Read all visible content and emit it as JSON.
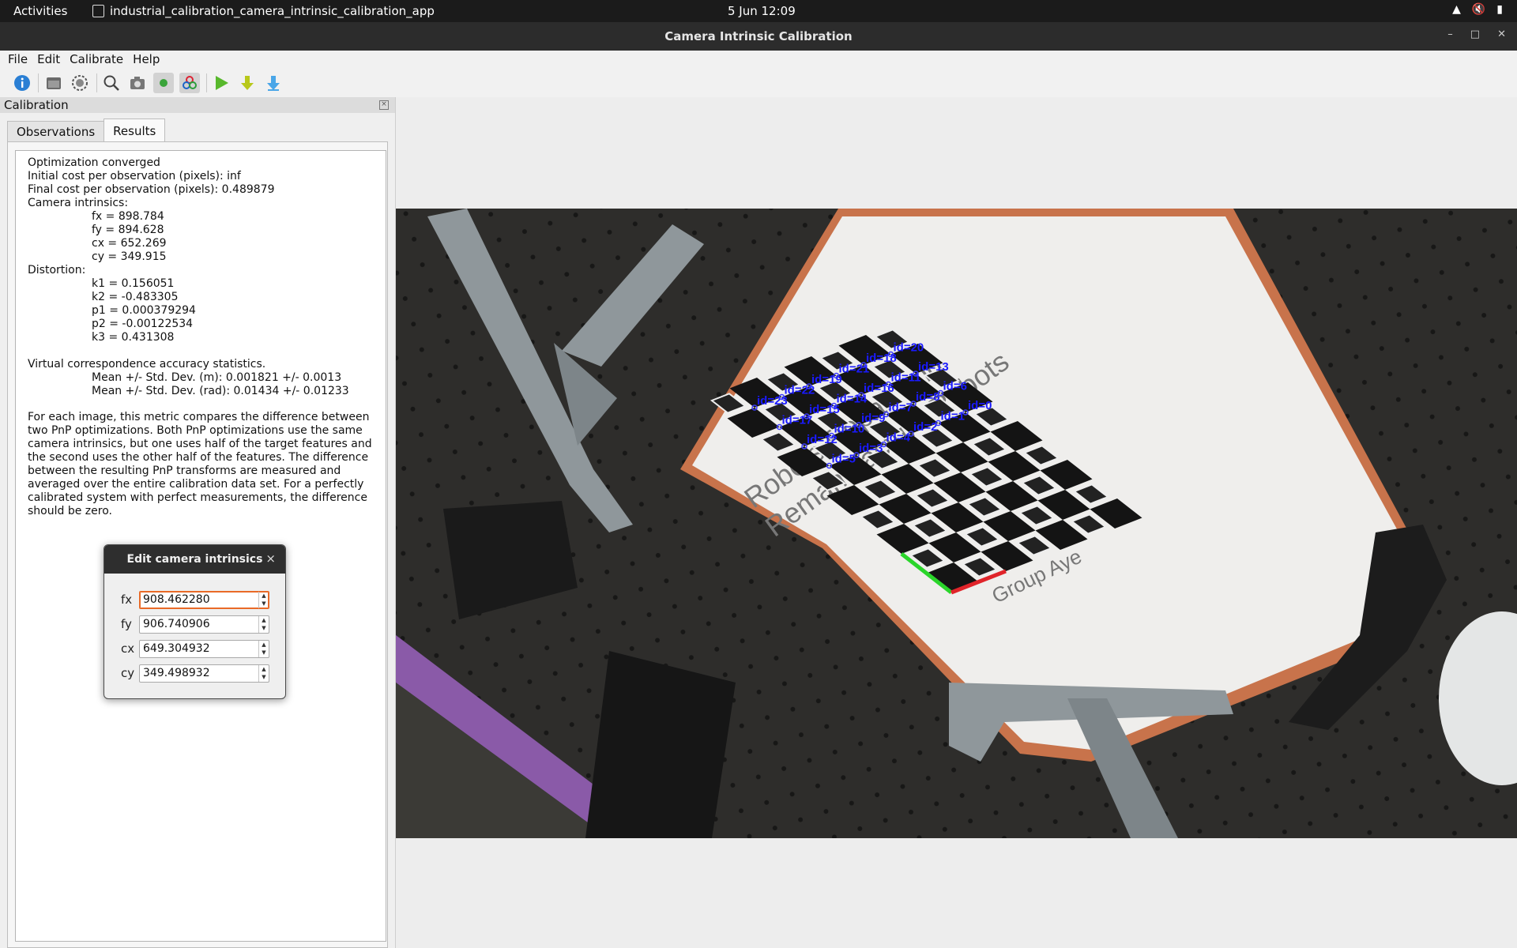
{
  "topbar": {
    "activities": "Activities",
    "app_title": "industrial_calibration_camera_intrinsic_calibration_app",
    "clock": "5 Jun  12:09"
  },
  "window": {
    "title": "Camera Intrinsic Calibration"
  },
  "menu": {
    "file": "File",
    "edit": "Edit",
    "calibrate": "Calibrate",
    "help": "Help"
  },
  "toolbar": {
    "icons": [
      "info-icon",
      "open-folder-icon",
      "settings-gear-icon",
      "zoom-inspect-icon",
      "camera-icon",
      "record-dot-icon",
      "robot-target-icon",
      "play-icon",
      "download-icon",
      "save-icon"
    ]
  },
  "dock": {
    "title": "Calibration",
    "tabs": {
      "observations": "Observations",
      "results": "Results"
    }
  },
  "results": {
    "l1": "Optimization converged",
    "l2": "Initial cost per observation (pixels): inf",
    "l3": "Final cost per observation (pixels): 0.489879",
    "l4": "Camera intrinsics:",
    "fx": "fx = 898.784",
    "fy": "fy = 894.628",
    "cx": "cx = 652.269",
    "cy": "cy = 349.915",
    "distortion": "Distortion:",
    "k1": "k1 = 0.156051",
    "k2": "k2 = -0.483305",
    "p1": "p1 = 0.000379294",
    "p2": "p2 = -0.00122534",
    "k3": "k3 = 0.431308",
    "vc": "Virtual correspondence accuracy statistics.",
    "mean_m": "Mean +/- Std. Dev. (m): 0.001821 +/- 0.0013",
    "mean_rad": "Mean +/- Std. Dev. (rad): 0.01434 +/- 0.01233",
    "paragraph": "For each image, this metric compares the difference between two PnP optimizations. Both PnP optimizations use the same camera intrinsics, but one uses half of the target features and the second uses the other half of the features. The difference between the resulting PnP transforms are measured and averaged over the entire calibration data set. For a perfectly calibrated system with perfect measurements, the difference should be zero."
  },
  "dialog": {
    "title": "Edit camera intrinsics",
    "fields": [
      {
        "label": "fx",
        "value": "908.462280"
      },
      {
        "label": "fy",
        "value": "906.740906"
      },
      {
        "label": "cx",
        "value": "649.304932"
      },
      {
        "label": "cy",
        "value": "349.498932"
      }
    ]
  },
  "camera_image": {
    "board_text_line1": "Robots Repair and",
    "board_text_line2": "Remanufacture Robots",
    "board_text_bottom": "Group Aye",
    "marker_labels": [
      "id=23",
      "id=22",
      "id=19",
      "id=21",
      "id=18",
      "id=20",
      "id=17",
      "id=15",
      "id=14",
      "id=16",
      "id=11",
      "id=13",
      "id=12",
      "id=10",
      "id=9",
      "id=7",
      "id=8",
      "id=6",
      "id=5",
      "id=3",
      "id=4",
      "id=2",
      "id=1",
      "id=0"
    ]
  }
}
